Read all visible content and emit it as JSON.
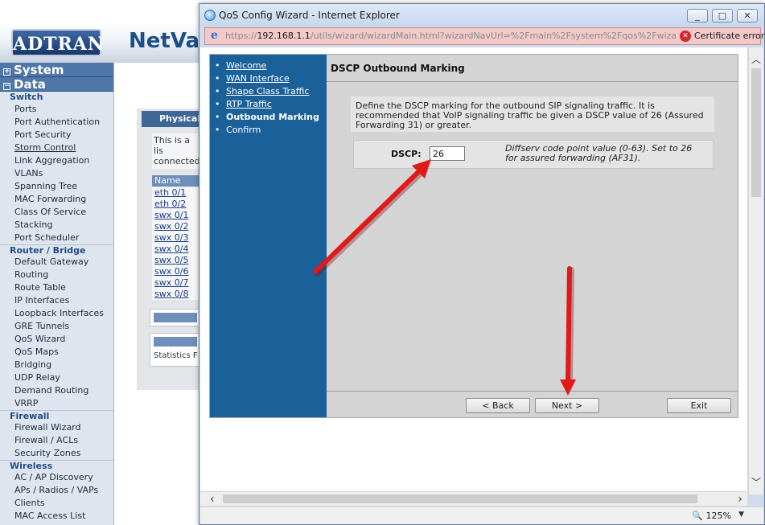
{
  "background": {
    "logo": "ADTRAN",
    "brand": "NetVa",
    "sidebar": {
      "system_label": "System",
      "data_label": "Data",
      "sections": [
        {
          "title": "Switch",
          "items": [
            "Ports",
            "Port Authentication",
            "Port Security",
            "Storm Control",
            "Link Aggregation",
            "VLANs",
            "Spanning Tree",
            "MAC Forwarding",
            "Class Of Service",
            "Stacking",
            "Port Scheduler"
          ]
        },
        {
          "title": "Router / Bridge",
          "items": [
            "Default Gateway",
            "Routing",
            "Route Table",
            "IP Interfaces",
            "Loopback Interfaces",
            "GRE Tunnels",
            "QoS Wizard",
            "QoS Maps",
            "Bridging",
            "UDP Relay",
            "Demand Routing",
            "VRRP"
          ]
        },
        {
          "title": "Firewall",
          "items": [
            "Firewall Wizard",
            "Firewall / ACLs",
            "Security Zones"
          ]
        },
        {
          "title": "Wireless",
          "items": [
            "AC / AP Discovery",
            "APs / Radios / VAPs",
            "Clients",
            "MAC Access List"
          ]
        }
      ]
    },
    "panel": {
      "title": "Physical",
      "text": "This is a lis connected name.",
      "column_header": "Name",
      "rows": [
        "eth 0/1",
        "eth 0/2",
        "swx 0/1",
        "swx 0/2",
        "swx 0/3",
        "swx 0/4",
        "swx 0/5",
        "swx 0/6",
        "swx 0/7",
        "swx 0/8"
      ],
      "stats_label": "Statistics F"
    }
  },
  "ie": {
    "title": "QoS Config Wizard - Internet Explorer",
    "url_prefix": "https://",
    "url_host": "192.168.1.1",
    "url_rest": "/utils/wizard/wizardMain.html?wizardNavUrl=%2Fmain%2Fsystem%2Fqos%2Fwizard%2Fwiza",
    "cert_text": "Certificate error",
    "zoom": "125%"
  },
  "wizard": {
    "nav": [
      {
        "label": "Welcome",
        "state": "link"
      },
      {
        "label": "WAN Interface",
        "state": "link"
      },
      {
        "label": "Shape Class Traffic",
        "state": "link"
      },
      {
        "label": "RTP Traffic",
        "state": "link"
      },
      {
        "label": "Outbound Marking",
        "state": "current"
      },
      {
        "label": "Confirm",
        "state": "plain"
      }
    ],
    "heading": "DSCP Outbound Marking",
    "description": "Define the DSCP marking for the outbound SIP signaling traffic. It is recommended that VoIP signaling traffic be given a DSCP value of 26 (Assured Forwarding 31) or greater.",
    "field_label": "DSCP:",
    "field_value": "26",
    "field_help": "Diffserv code point value (0-63). Set to 26 for assured forwarding (AF31).",
    "back_label": "< Back",
    "next_label": "Next >",
    "exit_label": "Exit"
  },
  "colors": {
    "wizard_nav_bg": "#1b6199",
    "wizard_body_bg": "#d4d4d4",
    "annotation_arrow": "#e0191a",
    "cert_error_bar": "#f2c8c8"
  }
}
